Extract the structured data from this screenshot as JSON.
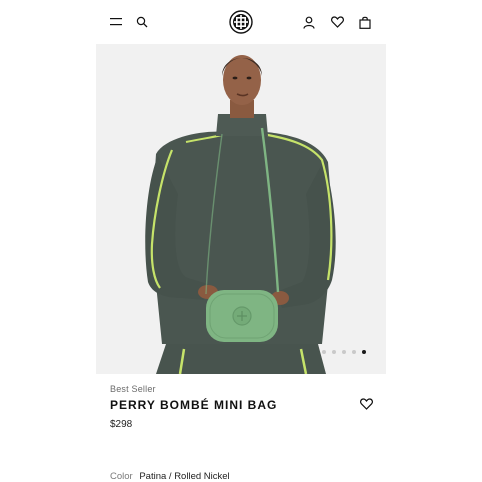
{
  "header": {
    "menu_icon": "hamburger-menu-icon",
    "search_icon": "search-icon",
    "logo": "tory-burch-logo",
    "account_icon": "user-icon",
    "wishlist_icon": "heart-icon",
    "bag_icon": "shopping-bag-icon"
  },
  "gallery": {
    "slide_count": 5,
    "active_slide": 5
  },
  "product": {
    "badge": "Best Seller",
    "title": "PERRY BOMBÉ MINI BAG",
    "price": "$298",
    "color_label": "Color",
    "color_value": "Patina / Rolled Nickel"
  },
  "colors": {
    "sweater": "#4a5650",
    "piping": "#c6e36a",
    "bag": "#7fb583",
    "background": "#f1f1f1"
  }
}
